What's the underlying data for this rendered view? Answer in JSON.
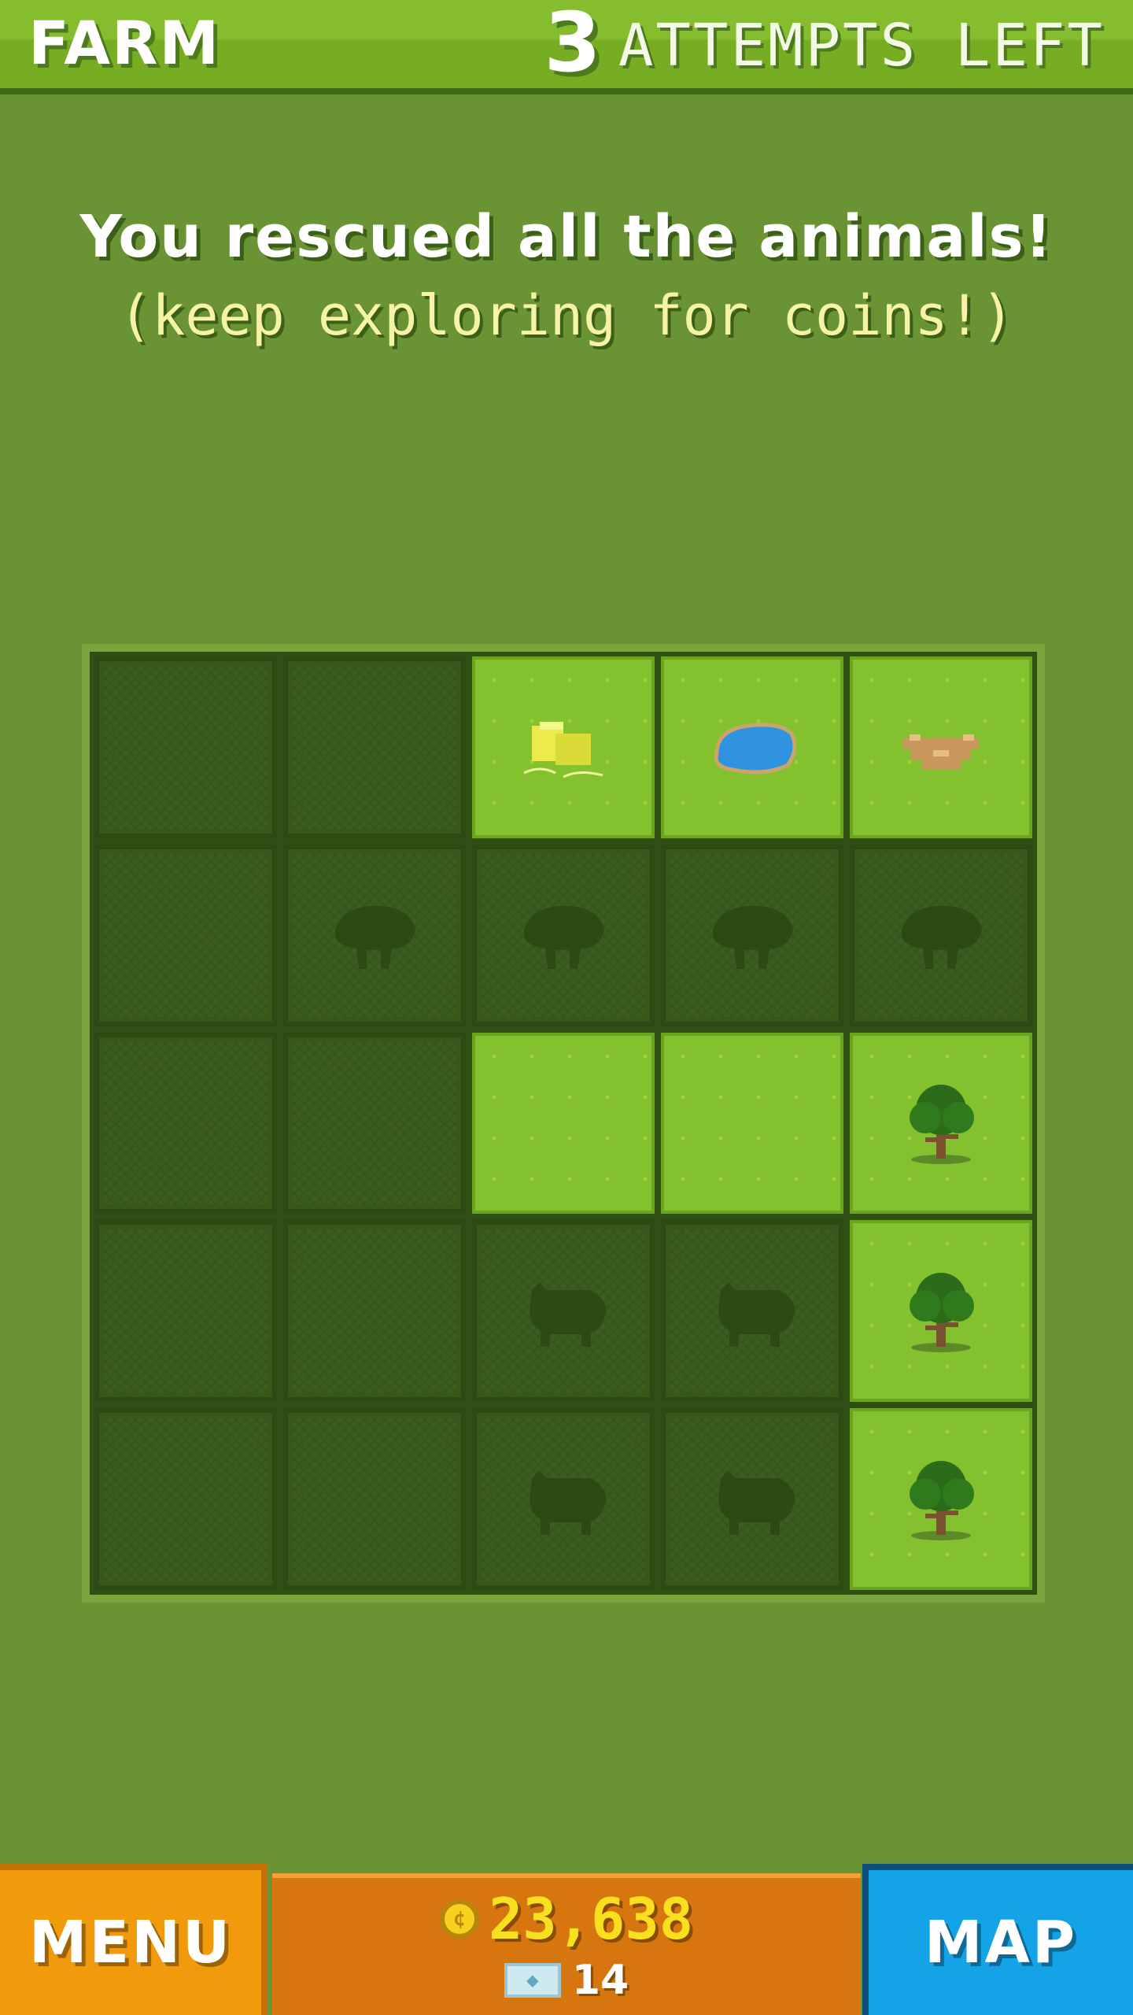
{
  "header": {
    "title": "FARM",
    "attempts": "3",
    "attempts_label": "ATTEMPTS LEFT"
  },
  "message": {
    "main": "You rescued all the animals!",
    "sub": "(keep exploring for coins!)"
  },
  "grid": {
    "rows": [
      [
        "hidden",
        "hidden",
        "hay",
        "pond",
        "nest"
      ],
      [
        "hidden",
        "sheep-silhouette",
        "sheep-silhouette",
        "sheep-silhouette",
        "sheep-silhouette"
      ],
      [
        "hidden",
        "hidden",
        "grass",
        "grass",
        "tree"
      ],
      [
        "hidden",
        "hidden",
        "pig-silhouette",
        "pig-silhouette",
        "tree"
      ],
      [
        "hidden",
        "hidden",
        "pig-silhouette",
        "pig-silhouette",
        "tree"
      ]
    ]
  },
  "footer": {
    "menu_label": "MENU",
    "map_label": "MAP",
    "coins": "23,638",
    "tickets": "14"
  },
  "colors": {
    "background": "#6a9434",
    "header": "#76ad22",
    "menu": "#f09a0c",
    "map": "#14a3e6",
    "wallet": "#d7750f",
    "coin_text": "#f8e01f"
  }
}
